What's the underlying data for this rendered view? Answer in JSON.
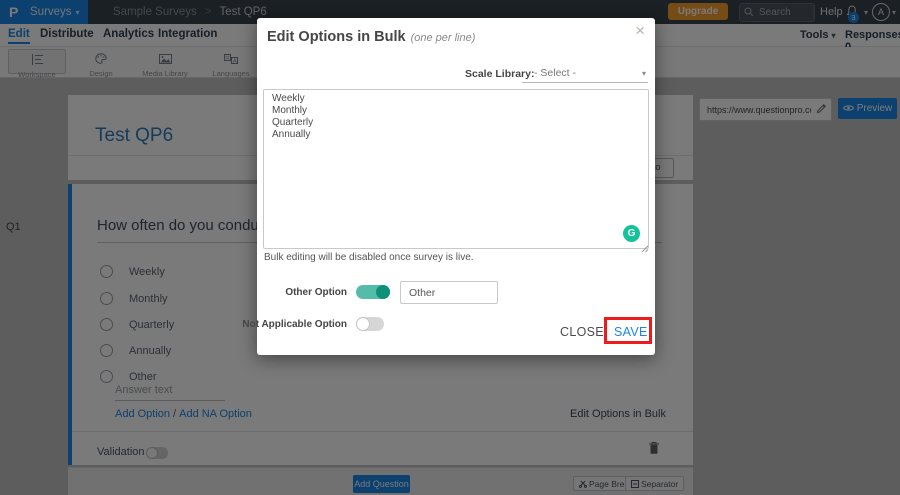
{
  "topbar": {
    "brand": "Surveys",
    "breadcrumb_parent": "Sample Surveys",
    "breadcrumb_current": "Test QP6",
    "upgrade_label": "Upgrade Now",
    "search_placeholder": "Search",
    "help_label": "Help",
    "notification_count": "3",
    "avatar_initial": "A"
  },
  "nav": {
    "tabs": [
      "Edit",
      "Distribute",
      "Analytics",
      "Integration"
    ],
    "tools_label": "Tools",
    "responses_label": "Responses: 0"
  },
  "toolbar": {
    "items": [
      "Workspace",
      "Design",
      "Media Library",
      "Languages"
    ],
    "url_fragment": "d",
    "survey_url": "https://www.questionpro.com/t/APNrFZ",
    "preview_label": "Preview"
  },
  "survey": {
    "title": "Test QP6",
    "intro_button": "Intro",
    "question_number": "Q1",
    "question_text": "How often do you conduct the",
    "options": [
      "Weekly",
      "Monthly",
      "Quarterly",
      "Annually",
      "Other"
    ],
    "answer_placeholder": "Answer text",
    "add_option_label": "Add Option",
    "slash": "/",
    "add_na_label": "Add NA Option",
    "edit_bulk_label": "Edit Options in Bulk",
    "validation_label": "Validation",
    "add_question_label": "Add Question",
    "page_break_label": "Page Break",
    "separator_label": "Separator"
  },
  "modal": {
    "title": "Edit Options in Bulk",
    "subtitle": "(one per line)",
    "scale_label": "Scale Library:",
    "scale_value": "- Select -",
    "options_text": "Weekly\nMonthly\nQuarterly\nAnnually",
    "note": "Bulk editing will be disabled once survey is live.",
    "other_label": "Other Option",
    "other_value": "Other",
    "na_label": "Not Applicable Option",
    "close_label": "CLOSE",
    "save_label": "SAVE",
    "grammarly_initial": "G"
  },
  "glyphs": {
    "caret": "▾",
    "breadcrumb_sep": ">",
    "close": "×"
  },
  "colors": {
    "accent_blue": "#1b87e6",
    "upgrade_orange": "#f49e2e",
    "grammarly_teal": "#15c39a",
    "toggle_on_teal": "#56bcaa",
    "save_highlight_red": "#ec1c1c"
  }
}
